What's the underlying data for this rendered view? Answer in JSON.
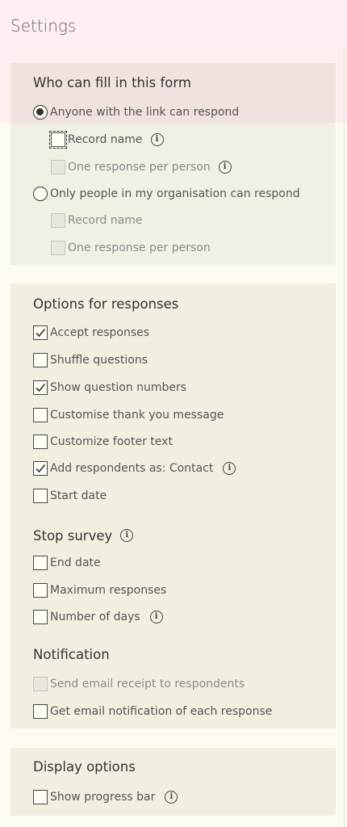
{
  "page": {
    "title": "Settings"
  },
  "who": {
    "heading": "Who can fill in this form",
    "anyone_label": "Anyone with the link can respond",
    "anyone_record_name": "Record name",
    "anyone_one_response": "One response per person",
    "org_label": "Only people in my organisation can respond",
    "org_record_name": "Record name",
    "org_one_response": "One response per person",
    "info_glyph": "i"
  },
  "options": {
    "heading": "Options for responses",
    "accept_responses": "Accept responses",
    "shuffle_questions": "Shuffle questions",
    "show_question_numbers": "Show question numbers",
    "customise_thank_you": "Customise thank you message",
    "customize_footer": "Customize footer text",
    "add_respondents": "Add respondents as: Contact",
    "start_date": "Start date"
  },
  "stop": {
    "heading": "Stop survey",
    "end_date": "End date",
    "maximum_responses": "Maximum responses",
    "number_of_days": "Number of days"
  },
  "notification": {
    "heading": "Notification",
    "send_email_receipt": "Send email receipt to respondents",
    "get_email_notification": "Get email notification of each response"
  },
  "display": {
    "heading": "Display options",
    "show_progress_bar": "Show progress bar"
  },
  "state": {
    "selected_audience": "Anyone with the link can respond",
    "checked": [
      "Accept responses",
      "Show question numbers",
      "Add respondents as: Contact"
    ]
  },
  "colors": {
    "top_band": "#fdeeef",
    "card": "#f2f0e5",
    "page": "#fdfbf1",
    "text": "#555555",
    "disabled_text": "#8a8a8a"
  },
  "icons": {
    "check": "check-icon",
    "info": "info-icon",
    "radio": "radio-button"
  }
}
